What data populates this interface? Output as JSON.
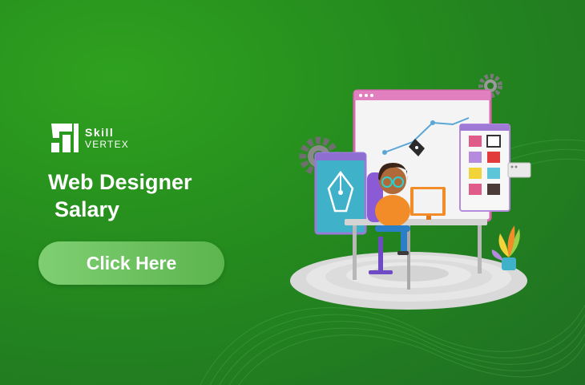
{
  "brand": {
    "name_line1": "Skill",
    "name_line2": "VERTEX",
    "logo_icon": "skillvertex-logo-mark"
  },
  "headline": {
    "line1": "Web Designer",
    "line2": "Salary"
  },
  "cta": {
    "label": "Click Here"
  },
  "illustration": {
    "subject": "designer-at-desk-illustration",
    "palette_swatches": [
      "#e05a8a",
      "#ffffff",
      "#b58be0",
      "#e23b3b",
      "#f2d43a",
      "#5cc6d8",
      "#e05a8a",
      "#4a3a38"
    ]
  },
  "colors": {
    "background": "#248a1e",
    "button": "#6cc25e",
    "text": "#ffffff"
  }
}
